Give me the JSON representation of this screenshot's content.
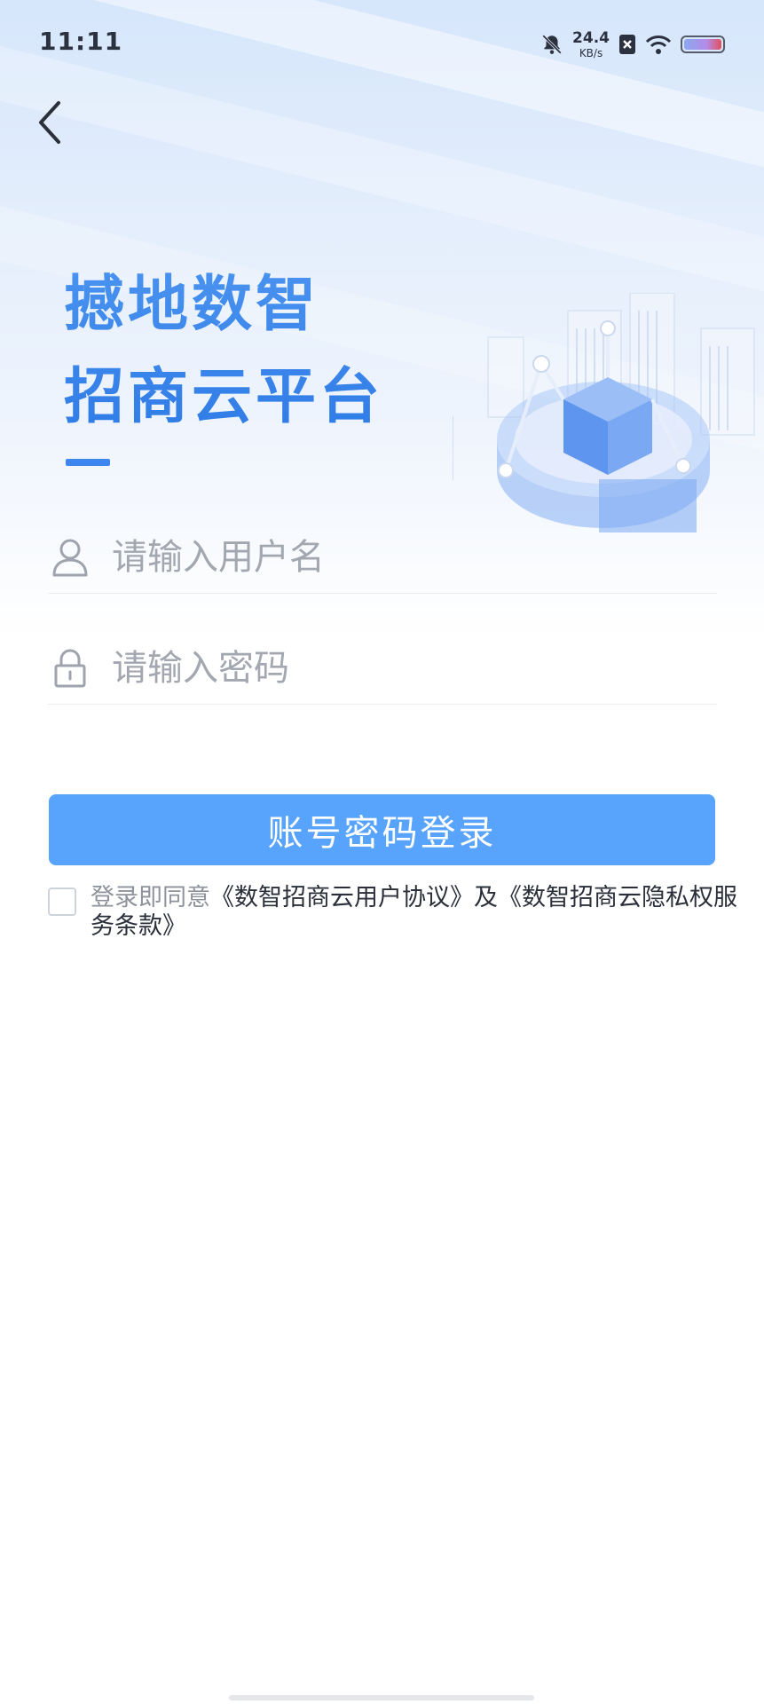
{
  "status_bar": {
    "time": "11:11",
    "net_speed_value": "24.4",
    "net_speed_unit": "KB/s",
    "icons": [
      "bell-off-icon",
      "sim-blocked-icon",
      "wifi-icon",
      "battery-icon"
    ]
  },
  "header": {
    "back_icon": "chevron-left-icon"
  },
  "hero": {
    "title_line1": "撼地数智",
    "title_line2": "招商云平台",
    "accent_color": "#3d86ee"
  },
  "form": {
    "username": {
      "icon": "user-icon",
      "placeholder": "请输入用户名",
      "value": ""
    },
    "password": {
      "icon": "lock-icon",
      "placeholder": "请输入密码",
      "value": ""
    },
    "login_button_label": "账号密码登录",
    "login_button_color": "#58a3fb"
  },
  "agreement": {
    "checked": false,
    "prefix": "登录即同意",
    "user_agreement": "《数智招商云用户协议》",
    "conjunction": "及",
    "privacy_policy": "《数智招商云隐私权服务条款》"
  }
}
